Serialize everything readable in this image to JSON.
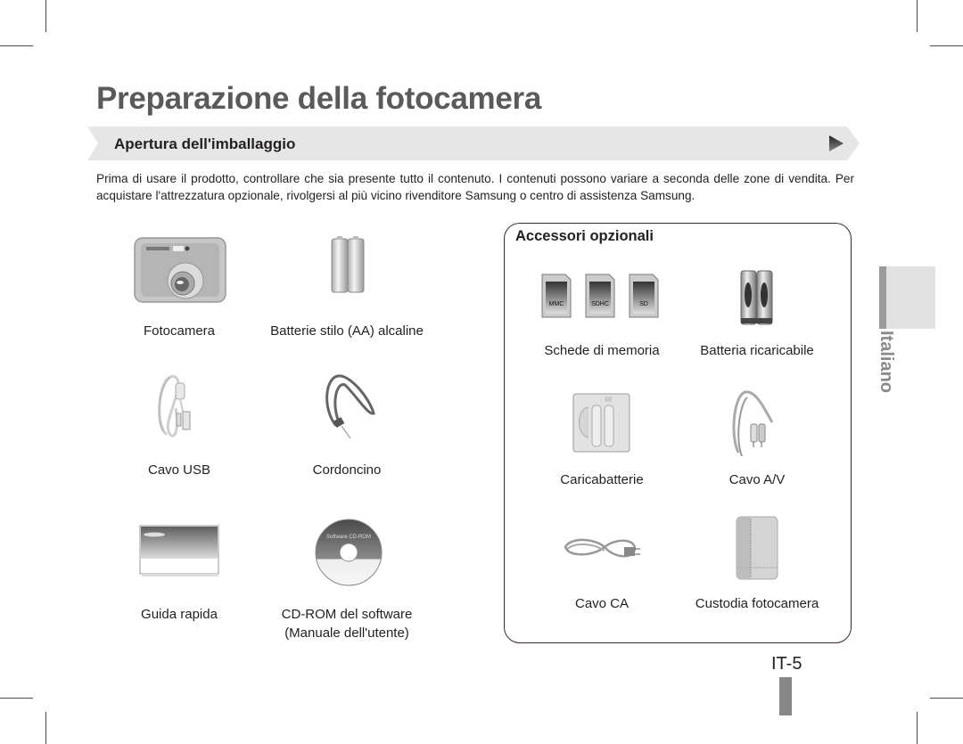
{
  "page": {
    "title": "Preparazione della fotocamera",
    "section_title": "Apertura dell'imballaggio",
    "intro": "Prima di usare il prodotto, controllare che sia presente tutto il contenuto. I contenuti possono variare a seconda delle zone di vendita. Per acquistare l'attrezzatura opzionale, rivolgersi al più vicino rivenditore Samsung o centro di assistenza Samsung.",
    "language_tab": "Italiano",
    "page_number": "IT-5"
  },
  "included_items": [
    {
      "label": "Fotocamera",
      "icon": "camera-icon"
    },
    {
      "label": "Batterie stilo (AA) alcaline",
      "icon": "aa-batteries-icon"
    },
    {
      "label": "Cavo USB",
      "icon": "usb-cable-icon"
    },
    {
      "label": "Cordoncino",
      "icon": "strap-icon"
    },
    {
      "label": "Guida rapida",
      "icon": "quick-guide-icon"
    },
    {
      "label": "CD-ROM del software",
      "label2": "(Manuale dell'utente)",
      "icon": "cd-rom-icon",
      "disc_text": "Software CD-ROM"
    }
  ],
  "optional": {
    "title": "Accessori opzionali",
    "items": [
      {
        "label": "Schede di memoria",
        "icon": "memory-cards-icon",
        "cards": [
          "MMC",
          "SDHC",
          "SD"
        ]
      },
      {
        "label": "Batteria ricaricabile",
        "icon": "rechargeable-battery-icon"
      },
      {
        "label": "Caricabatterie",
        "icon": "charger-icon"
      },
      {
        "label": "Cavo A/V",
        "icon": "av-cable-icon"
      },
      {
        "label": "Cavo CA",
        "icon": "ac-cable-icon"
      },
      {
        "label": "Custodia fotocamera",
        "icon": "camera-case-icon"
      }
    ]
  }
}
